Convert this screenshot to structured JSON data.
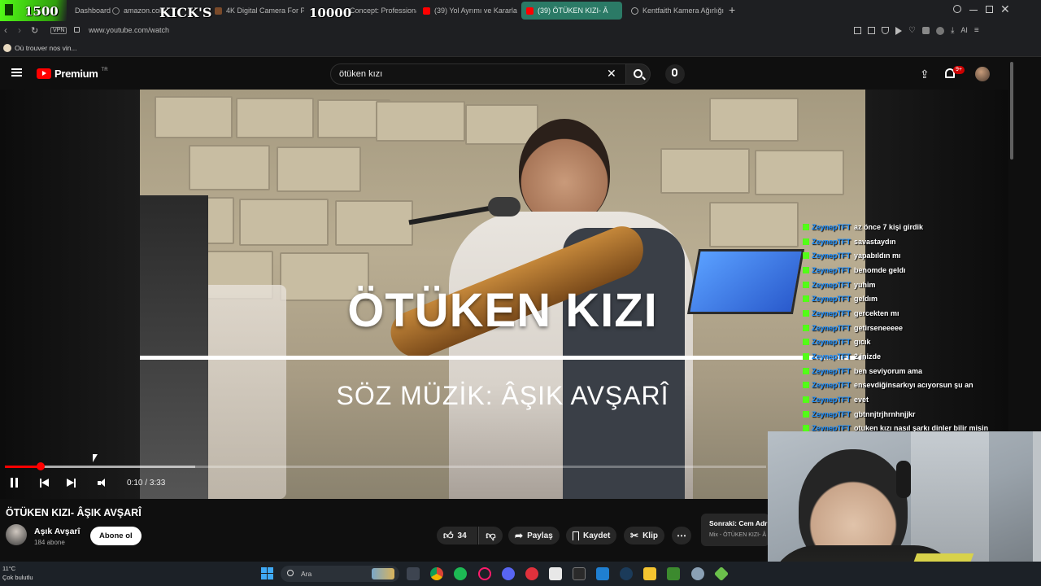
{
  "overlay": {
    "left_number": "1500",
    "title": "KICK'S",
    "right_number": "10000"
  },
  "browser": {
    "tabs": [
      {
        "label": "Dashboard"
      },
      {
        "label": "amazon.com"
      },
      {
        "label": "4K Digital Camera For Ph"
      },
      {
        "label": "Concept: Professiona"
      },
      {
        "label": "(39) Yol Ayrımı ve Kararla"
      },
      {
        "label": "(39) ÖTÜKEN KIZI- Â"
      },
      {
        "label": "Kentfaith Kamera Ağırlığı"
      }
    ],
    "vpn_label": "VPN",
    "url": "www.youtube.com/watch",
    "ai_label": "AI",
    "bookmark": "Où trouver nos vin..."
  },
  "youtube": {
    "logo_text": "Premium",
    "logo_region": "TR",
    "search_query": "ötüken kızı",
    "notification_badge": "9+"
  },
  "video": {
    "title_overlay": "ÖTÜKEN KIZI",
    "subtitle_overlay": "SÖZ MÜZİK: ÂŞIK AVŞARÎ",
    "current_time": "0:10",
    "time_separator": " / ",
    "duration": "3:33",
    "progress": 0.047,
    "buffered": 0.25
  },
  "chat": {
    "lines": [
      {
        "user": "ZeynepTFT",
        "message": "az önce 7 kişi girdik"
      },
      {
        "user": "ZeynepTFT",
        "message": "savastaydın"
      },
      {
        "user": "ZeynepTFT",
        "message": "yapabıldın mı"
      },
      {
        "user": "ZeynepTFT",
        "message": "benomde geldı"
      },
      {
        "user": "ZeynepTFT",
        "message": "yuhim"
      },
      {
        "user": "ZeynepTFT",
        "message": "geldım"
      },
      {
        "user": "ZeynepTFT",
        "message": "gercekten mı"
      },
      {
        "user": "ZeynepTFT",
        "message": "getirseneeeee"
      },
      {
        "user": "ZeynepTFT",
        "message": "gıcık"
      },
      {
        "user": "ZeynepTFT",
        "message": "2 inizde"
      },
      {
        "user": "ZeynepTFT",
        "message": "ben seviyorum ama"
      },
      {
        "user": "ZeynepTFT",
        "message": "ensevdiğinsarkıyı acıyorsun şu an"
      },
      {
        "user": "ZeynepTFT",
        "message": "evet"
      },
      {
        "user": "ZeynepTFT",
        "message": "gbtnnjtrjhrnhnjjkr"
      },
      {
        "user": "ZeynepTFT",
        "message": "otuken kızı nasıl şarkı dinler bilir misin"
      }
    ]
  },
  "details": {
    "title": "ÖTÜKEN KIZI- ÂŞIK AVŞARÎ",
    "channel": "Aşık Avşarî",
    "subscribers": "184 abone",
    "subscribe_label": "Abone ol",
    "likes": "34",
    "share_label": "Paylaş",
    "save_label": "Kaydet",
    "clip_label": "Klip",
    "next_label": "Sonraki: Cem Adr",
    "next_sub": "Mix - ÖTÜKEN KIZI- Â"
  },
  "taskbar": {
    "temperature": "11°C",
    "weather": "Çok bulutlu",
    "search_label": "Ara"
  },
  "colors": {
    "accent_red": "#ff0000",
    "kick_green": "#53fc18",
    "active_tab": "#2b7a66",
    "chat_user": "#1e90ff"
  }
}
